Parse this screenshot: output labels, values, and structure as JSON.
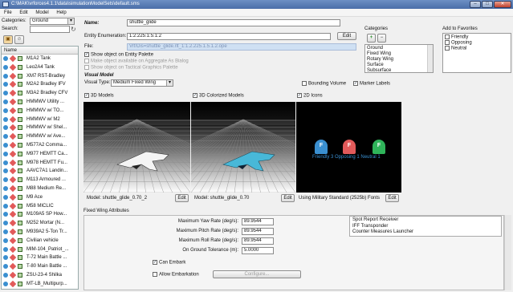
{
  "window": {
    "title": "C:\\MAK\\vrforces4.1.1\\data\\simulationModelSets\\default.sms"
  },
  "menu": [
    "File",
    "Edit",
    "Model",
    "Help"
  ],
  "left_panel": {
    "categories_label": "Categories:",
    "categories_value": "Ground",
    "search_label": "Search:",
    "list_header": "Name",
    "items": [
      "M1A2 Tank",
      "Leo2A4 Tank",
      "XM7 RST-Bradley",
      "M2A2 Bradley IFV",
      "M3A2 Bradley CFV",
      "HMMWV Utility ...",
      "HMMWV w/ TO...",
      "HMMWV w/ M2",
      "HMMWV w/ Shel...",
      "HMMWV w/ Ave...",
      "M577A2 Comma...",
      "M977 HEMTT Ca...",
      "M978 HEMTT Fu...",
      "AAVC7A1 Landin...",
      "M113 Armoured ...",
      "M88 Medium Re...",
      "M9 Ace",
      "M58 MICLIC",
      "M109A5 SP How...",
      "M252 Mortar (N...",
      "M939A2 5-Ton Tr...",
      "Civilian vehicle",
      "MIM-104_Patriot_...",
      "T-72 Main Battle ...",
      "T-80 Main Battle ...",
      "ZSU-23-4 Shilka",
      "MT-LB_Multipurp..."
    ]
  },
  "center": {
    "name_label": "Name:",
    "name_value": "shuttle_glide",
    "enum_label": "Entity Enumeration:",
    "enum_value": "1:2:225:1:5:1:2",
    "enum_edit": "Edit",
    "file_label": "File:",
    "file_value": "Vrf/Dis=shuttle_glide.rlt_1:1.2.225.1.5.1.2.ope",
    "show_entity_palette": "Show object on Entity Palette",
    "aggregate_as_bialog": "Make object available on Aggregate As Bialog",
    "show_tactical_palette": "Show object on Tactical Graphics Palette",
    "visual_model_label": "Visual Model",
    "visual_type_label": "Visual Type:",
    "visual_type_value": "Medium Fixed Wing",
    "bounding_volume": "Bounding Volume",
    "marker_labels": "Marker Labels",
    "models_3d": "3D Models",
    "models_3d_colorized": "3D Colorized Models",
    "icons_2d": "2D Icons",
    "model1_label": "Model: shuttle_glide_0.70_2",
    "model1_edit": "Edit",
    "model2_label": "Model: shuttle_glide_0.70",
    "model2_edit": "Edit",
    "model3_label": "Using Military Standard (2525b) Fonts",
    "model3_edit": "Edit",
    "tac_labels": [
      "F",
      "F",
      "F"
    ],
    "tac_caption": "Friendly 3   Opposing 1  Neutral 1",
    "fw_header": "Fixed Wing Attributes",
    "attrs": [
      {
        "label": "Maximum Yaw Rate (deg/s):",
        "value": "89.9544"
      },
      {
        "label": "Maximum Pitch Rate (deg/s):",
        "value": "89.9544"
      },
      {
        "label": "Maximum Roll Rate (deg/s):",
        "value": "89.9544"
      },
      {
        "label": "On Ground Tolerance (m):",
        "value": "5.0000"
      }
    ],
    "can_embark": "Can Embark",
    "allow_embarkation": "Allow Embarkation",
    "configure": "Configure..."
  },
  "categories_panel": {
    "label": "Categories",
    "items": [
      "Ground",
      "Fixed Wing",
      "Rotary Wing",
      "Surface",
      "Subsurface"
    ],
    "lower_items": [
      "Spot Report Receiver",
      "IFF Transponder",
      "Counter Measures Launcher"
    ]
  },
  "favorites_panel": {
    "label": "Add to Favorites",
    "items": [
      "Friendly",
      "Opposing",
      "Neutral"
    ]
  },
  "colors": {
    "friendly": "#3a8fd0",
    "opposing": "#e25a5a",
    "neutral": "#2fb45a",
    "viewport_bg": "#000000"
  }
}
